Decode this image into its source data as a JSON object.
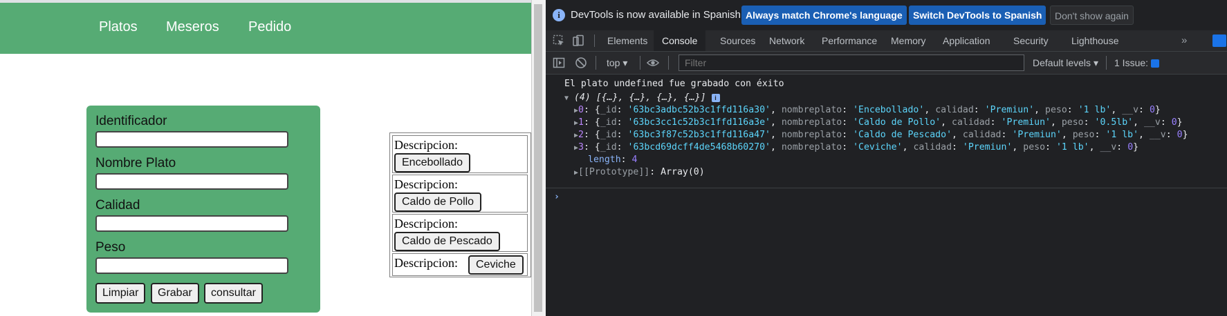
{
  "nav": {
    "items": [
      "Platos",
      "Meseros",
      "Pedido"
    ]
  },
  "form": {
    "labels": {
      "id": "Identificador",
      "name": "Nombre Plato",
      "quality": "Calidad",
      "weight": "Peso"
    },
    "values": {
      "id": "",
      "name": "",
      "quality": "",
      "weight": ""
    },
    "buttons": {
      "clear": "Limpiar",
      "save": "Grabar",
      "query": "consultar"
    }
  },
  "descriptions": {
    "label": "Descripcion:",
    "items": [
      "Encebollado",
      "Caldo de Pollo",
      "Caldo de Pescado",
      "Ceviche"
    ]
  },
  "devtools": {
    "infobar": {
      "message": "DevTools is now available in Spanish!",
      "btn_match": "Always match Chrome's language",
      "btn_switch": "Switch DevTools to Spanish",
      "btn_dismiss": "Don't show again"
    },
    "tabs": [
      "Elements",
      "Console",
      "Sources",
      "Network",
      "Performance",
      "Memory",
      "Application",
      "Security",
      "Lighthouse"
    ],
    "active_tab": "Console",
    "toolbar": {
      "context": "top",
      "filter_placeholder": "Filter",
      "levels": "Default levels",
      "issues": "1 Issue:"
    },
    "console": {
      "log_message": "El plato undefined fue grabado con éxito",
      "array_summary": "(4) [{…}, {…}, {…}, {…}]",
      "rows": [
        {
          "index": "0",
          "id": "'63bc3adbc52b3c1ffd116a30'",
          "nombreplato": "'Encebollado'",
          "calidad": "'Premiun'",
          "peso": "'1 lb'",
          "v": "0"
        },
        {
          "index": "1",
          "id": "'63bc3cc1c52b3c1ffd116a3e'",
          "nombreplato": "'Caldo de Pollo'",
          "calidad": "'Premiun'",
          "peso": "'0.5lb'",
          "v": "0"
        },
        {
          "index": "2",
          "id": "'63bc3f87c52b3c1ffd116a47'",
          "nombreplato": "'Caldo de Pescado'",
          "calidad": "'Premiun'",
          "peso": "'1 lb'",
          "v": "0"
        },
        {
          "index": "3",
          "id": "'63bcd69dcff4de5468b60270'",
          "nombreplato": "'Ceviche'",
          "calidad": "'Premiun'",
          "peso": "'1 lb'",
          "v": "0"
        }
      ],
      "length_key": "length",
      "length_value": "4",
      "prototype_key": "[[Prototype]]",
      "prototype_value": "Array(0)"
    }
  }
}
